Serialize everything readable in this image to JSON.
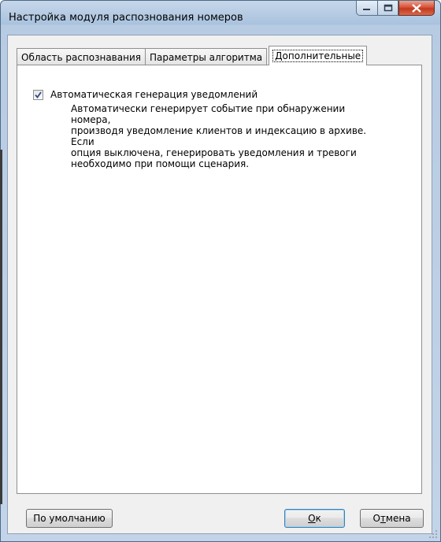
{
  "window": {
    "title": "Настройка модуля распознования номеров"
  },
  "tabs": [
    {
      "label": "Область распознавания",
      "active": false
    },
    {
      "label": "Параметры алгоритма",
      "active": false
    },
    {
      "label": "Дополнительные",
      "active": true
    }
  ],
  "options": {
    "auto_notifications": {
      "label": "Автоматическая генерация уведомлений",
      "checked": true,
      "description_lines": [
        "Автоматически генерирует событие при обнаружении номера,",
        "производя уведомление клиентов и индексацию в архиве. Если",
        "опция выключена, генерировать уведомления и тревоги",
        "необходимо при помощи сценария."
      ]
    }
  },
  "buttons": {
    "defaults": "По умолчанию",
    "ok_prefix": "",
    "ok_mnemonic": "О",
    "ok_rest": "к",
    "cancel_prefix": "О",
    "cancel_mnemonic": "т",
    "cancel_rest": "мена"
  },
  "colors": {
    "close_button": "#c4381e",
    "frame": "#a9c2de",
    "client_bg": "#f0f0f0"
  }
}
